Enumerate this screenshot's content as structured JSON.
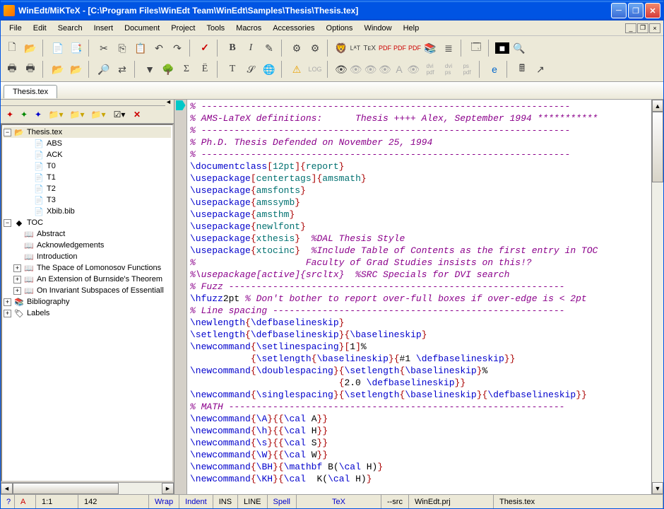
{
  "title": "WinEdt/MiKTeX - [C:\\Program Files\\WinEdt Team\\WinEdt\\Samples\\Thesis\\Thesis.tex]",
  "menus": [
    "File",
    "Edit",
    "Search",
    "Insert",
    "Document",
    "Project",
    "Tools",
    "Macros",
    "Accessories",
    "Options",
    "Window",
    "Help"
  ],
  "doc_tab": "Thesis.tex",
  "tree": {
    "root": "Thesis.tex",
    "files": [
      "ABS",
      "ACK",
      "T0",
      "T1",
      "T2",
      "T3",
      "Xbib.bib"
    ],
    "toc_label": "TOC",
    "toc_items": [
      "Abstract",
      "Acknowledgements",
      "Introduction",
      "The Space of Lomonosov Functions",
      "An Extension of Burnside's Theorem",
      "On Invariant Subspaces of Essentiall"
    ],
    "bibliography": "Bibliography",
    "labels": "Labels"
  },
  "editor_lines": [
    {
      "t": "comment",
      "s": "% -------------------------------------------------------------------"
    },
    {
      "t": "comment",
      "s": "% AMS-LaTeX definitions:      Thesis ++++ Alex, September 1994 ***********"
    },
    {
      "t": "comment",
      "s": "% -------------------------------------------------------------------"
    },
    {
      "t": "comment",
      "s": "% Ph.D. Thesis Defended on November 25, 1994"
    },
    {
      "t": "comment",
      "s": "% -------------------------------------------------------------------"
    },
    {
      "t": "cmd",
      "p": [
        "\\documentclass",
        "[",
        "12pt",
        "]{",
        "report",
        "}"
      ]
    },
    {
      "t": "cmd",
      "p": [
        "\\usepackage",
        "[",
        "centertags",
        "]{",
        "amsmath",
        "}"
      ]
    },
    {
      "t": "cmd",
      "p": [
        "\\usepackage",
        "{",
        "amsfonts",
        "}"
      ]
    },
    {
      "t": "cmd",
      "p": [
        "\\usepackage",
        "{",
        "amssymb",
        "}"
      ]
    },
    {
      "t": "cmd",
      "p": [
        "\\usepackage",
        "{",
        "amsthm",
        "}"
      ]
    },
    {
      "t": "cmd",
      "p": [
        "\\usepackage",
        "{",
        "newlfont",
        "}"
      ]
    },
    {
      "t": "cmdcmt",
      "p": [
        "\\usepackage",
        "{",
        "xthesis",
        "}"
      ],
      "c": "  %DAL Thesis Style"
    },
    {
      "t": "cmdcmt",
      "p": [
        "\\usepackage",
        "{",
        "xtocinc",
        "}"
      ],
      "c": "  %Include Table of Contents as the first entry in TOC"
    },
    {
      "t": "comment",
      "s": "%                    Faculty of Grad Studies insists on this!?"
    },
    {
      "t": "comment",
      "s": "%\\usepackage[active]{srcltx}  %SRC Specials for DVI search"
    },
    {
      "t": "comment",
      "s": "% Fuzz -------------------------------------------------------------"
    },
    {
      "t": "mixed",
      "s": "\\hfuzz2pt % Don't bother to report over-full boxes if over-edge is < 2pt"
    },
    {
      "t": "comment",
      "s": "% Line spacing -----------------------------------------------------"
    },
    {
      "t": "cmd",
      "p": [
        "\\newlength",
        "{",
        "\\defbaselineskip",
        "}"
      ]
    },
    {
      "t": "cmd",
      "p": [
        "\\setlength",
        "{",
        "\\defbaselineskip",
        "}{",
        "\\baselineskip",
        "}"
      ]
    },
    {
      "t": "raw",
      "s": "\\newcommand{\\setlinespacing}[1]%"
    },
    {
      "t": "raw",
      "s": "           {\\setlength{\\baselineskip}{#1 \\defbaselineskip}}"
    },
    {
      "t": "raw",
      "s": "\\newcommand{\\doublespacing}{\\setlength{\\baselineskip}%"
    },
    {
      "t": "raw",
      "s": "                           {2.0 \\defbaselineskip}}"
    },
    {
      "t": "raw",
      "s": "\\newcommand{\\singlespacing}{\\setlength{\\baselineskip}{\\defbaselineskip}}"
    },
    {
      "t": "comment",
      "s": "% MATH -------------------------------------------------------------"
    },
    {
      "t": "raw",
      "s": "\\newcommand{\\A}{{\\cal A}}"
    },
    {
      "t": "raw",
      "s": "\\newcommand{\\h}{{\\cal H}}"
    },
    {
      "t": "raw",
      "s": "\\newcommand{\\s}{{\\cal S}}"
    },
    {
      "t": "raw",
      "s": "\\newcommand{\\W}{{\\cal W}}"
    },
    {
      "t": "raw",
      "s": "\\newcommand{\\BH}{\\mathbf B(\\cal H)}"
    },
    {
      "t": "raw",
      "s": "\\newcommand{\\KH}{\\cal  K(\\cal H)}"
    }
  ],
  "status": {
    "q": "?",
    "a": "A",
    "pos": "1:1",
    "col": "142",
    "wrap": "Wrap",
    "indent": "Indent",
    "ins": "INS",
    "line": "LINE",
    "spell": "Spell",
    "tex": "TeX",
    "src": "--src",
    "prj": "WinEdt.prj",
    "file": "Thesis.tex"
  }
}
